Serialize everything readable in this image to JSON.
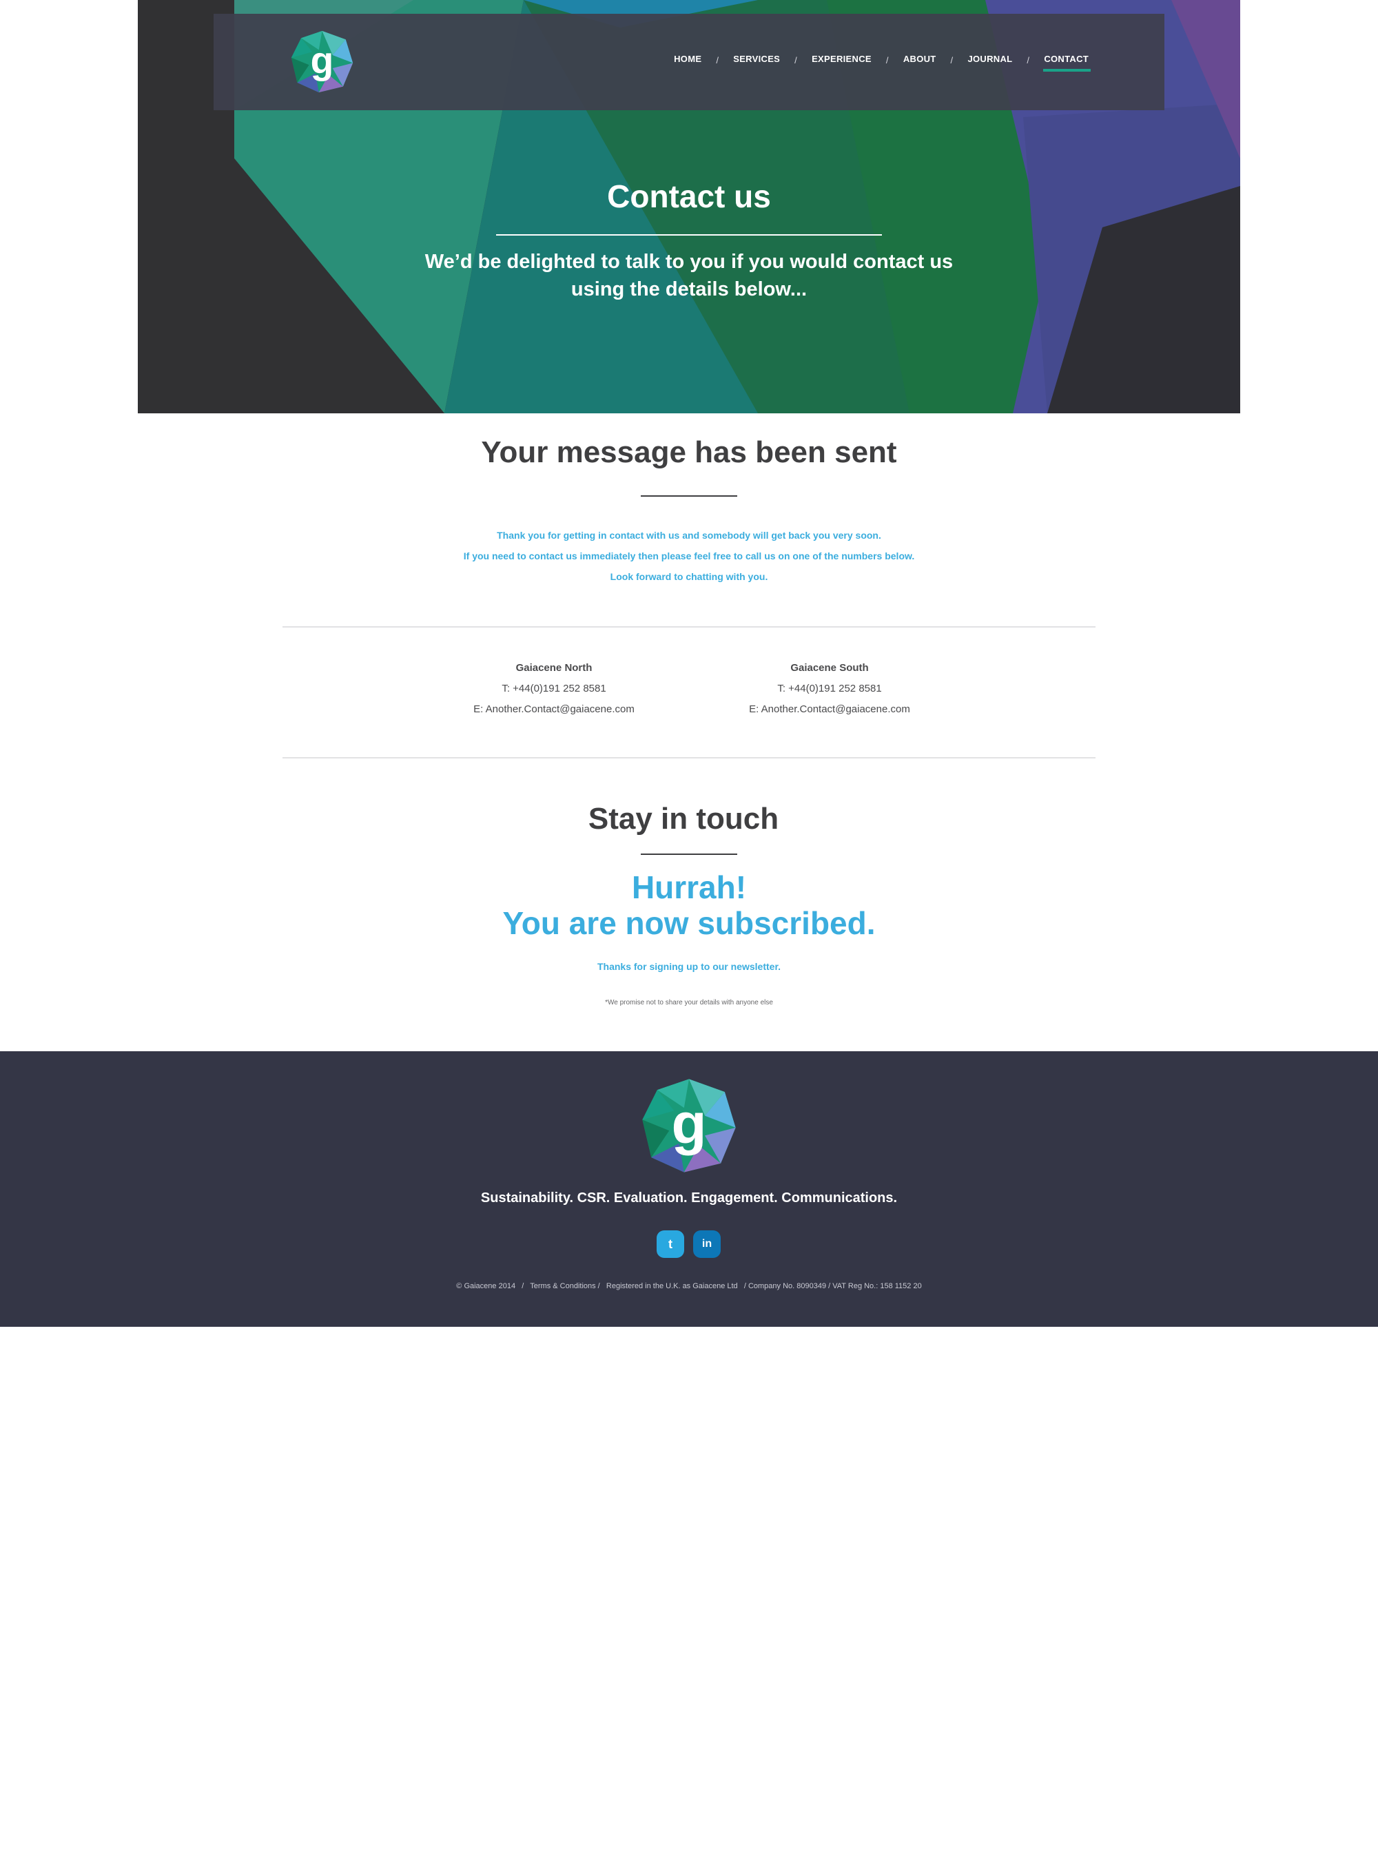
{
  "nav": {
    "items": [
      {
        "label": "HOME"
      },
      {
        "label": "SERVICES"
      },
      {
        "label": "EXPERIENCE"
      },
      {
        "label": "ABOUT"
      },
      {
        "label": "JOURNAL"
      },
      {
        "label": "CONTACT",
        "active": true
      }
    ],
    "separator": "/"
  },
  "hero": {
    "title": "Contact us",
    "subtitle": "We’d be delighted to talk to you if you would contact us using the details below..."
  },
  "message": {
    "title": "Your message has been sent",
    "lines": [
      "Thank you for getting in contact with us and somebody will get back you very soon.",
      "If you need to contact us immediately then please feel free to call us on one of the numbers below.",
      "Look forward to chatting with you."
    ]
  },
  "offices": [
    {
      "name": "Gaiacene North",
      "phone": "T: +44(0)191 252 8581",
      "email": "E: Another.Contact@gaiacene.com"
    },
    {
      "name": "Gaiacene South",
      "phone": "T: +44(0)191 252 8581",
      "email": "E: Another.Contact@gaiacene.com"
    }
  ],
  "newsletter": {
    "title": "Stay in touch",
    "headline_1": "Hurrah!",
    "headline_2": "You are now subscribed.",
    "thanks": "Thanks for signing up to our newsletter.",
    "note": "*We promise not to share your details with anyone else"
  },
  "footer": {
    "tagline": "Sustainability. CSR. Evaluation. Engagement. Communications.",
    "legal": "© Gaiacene 2014   /   Terms & Conditions /   Registered in the U.K. as Gaiacene Ltd   / Company No. 8090349 / VAT Reg No.: 158 1152 20",
    "social": [
      {
        "icon": "twitter-icon",
        "glyph": "t",
        "color": "#29a8e0"
      },
      {
        "icon": "linkedin-icon",
        "glyph": "in",
        "color": "#0d77b7"
      }
    ]
  },
  "colors": {
    "accent_blue": "#3badde",
    "accent_green": "#1aa389",
    "dark_text": "#3f3f41",
    "footer_bg": "#343646"
  }
}
